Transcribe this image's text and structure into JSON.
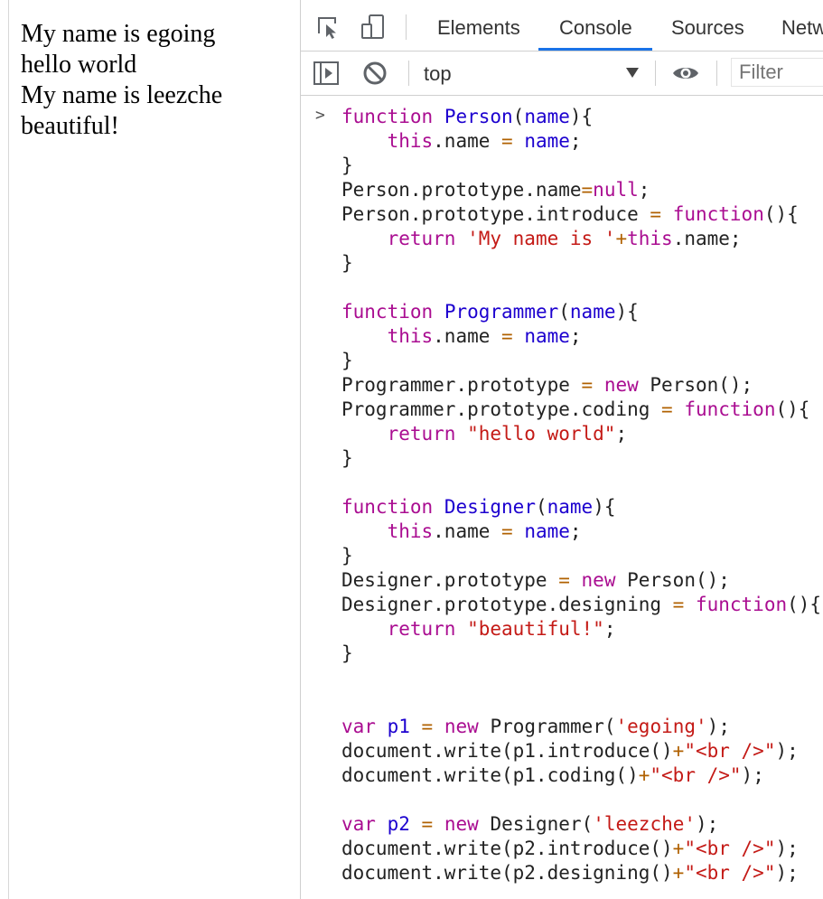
{
  "page": {
    "lines": [
      "My name is egoing",
      "hello world",
      "My name is leezche",
      "beautiful!"
    ]
  },
  "devtools": {
    "tabs": [
      "Elements",
      "Console",
      "Sources",
      "Netw"
    ],
    "active_tab": "Console",
    "toolbar_icons": [
      "inspect-element-icon",
      "device-toolbar-icon"
    ],
    "console_toolbar_icons": [
      "sidebar-toggle-icon",
      "clear-console-icon",
      "live-expression-eye-icon"
    ],
    "context": "top",
    "filter_placeholder": "Filter",
    "prompt_symbol": ">",
    "accent_color": "#1a73e8"
  },
  "console": {
    "code_lines": [
      "function Person(name){",
      "    this.name = name;",
      "}",
      "Person.prototype.name=null;",
      "Person.prototype.introduce = function(){",
      "    return 'My name is '+this.name;",
      "}",
      "",
      "function Programmer(name){",
      "    this.name = name;",
      "}",
      "Programmer.prototype = new Person();",
      "Programmer.prototype.coding = function(){",
      "    return \"hello world\";",
      "}",
      "",
      "function Designer(name){",
      "    this.name = name;",
      "}",
      "Designer.prototype = new Person();",
      "Designer.prototype.designing = function(){",
      "    return \"beautiful!\";",
      "}",
      "",
      "",
      "var p1 = new Programmer('egoing');",
      "document.write(p1.introduce()+\"<br />\");",
      "document.write(p1.coding()+\"<br />\");",
      "",
      "var p2 = new Designer('leezche');",
      "document.write(p2.introduce()+\"<br />\");",
      "document.write(p2.designing()+\"<br />\");"
    ]
  }
}
